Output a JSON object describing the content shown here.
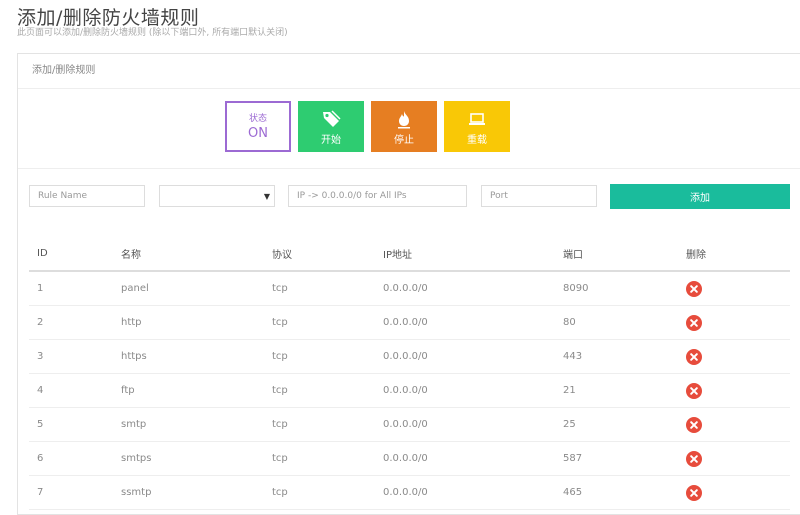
{
  "page": {
    "title": "添加/删除防火墙规则",
    "subtitle": "此页面可以添加/删除防火墙规则 (除以下端口外, 所有端口默认关闭)"
  },
  "panel": {
    "heading": "添加/删除规则"
  },
  "controls": {
    "status": {
      "label": "状态",
      "value": "ON"
    },
    "start": {
      "label": "开始",
      "icon": "tag-icon",
      "color": "#2ecc71"
    },
    "stop": {
      "label": "停止",
      "icon": "fire-icon",
      "color": "#e67e22"
    },
    "reload": {
      "label": "重载",
      "icon": "laptop-icon",
      "color": "#f9c806"
    }
  },
  "form": {
    "name_placeholder": "Rule Name",
    "protocol_selected": "",
    "ip_placeholder": "IP -> 0.0.0.0/0 for All IPs",
    "port_placeholder": "Port",
    "add_label": "添加",
    "add_color": "#1abc9c"
  },
  "table": {
    "headers": [
      "ID",
      "名称",
      "协议",
      "IP地址",
      "端口",
      "删除"
    ],
    "rows": [
      {
        "id": "1",
        "name": "panel",
        "protocol": "tcp",
        "ip": "0.0.0.0/0",
        "port": "8090"
      },
      {
        "id": "2",
        "name": "http",
        "protocol": "tcp",
        "ip": "0.0.0.0/0",
        "port": "80"
      },
      {
        "id": "3",
        "name": "https",
        "protocol": "tcp",
        "ip": "0.0.0.0/0",
        "port": "443"
      },
      {
        "id": "4",
        "name": "ftp",
        "protocol": "tcp",
        "ip": "0.0.0.0/0",
        "port": "21"
      },
      {
        "id": "5",
        "name": "smtp",
        "protocol": "tcp",
        "ip": "0.0.0.0/0",
        "port": "25"
      },
      {
        "id": "6",
        "name": "smtps",
        "protocol": "tcp",
        "ip": "0.0.0.0/0",
        "port": "587"
      },
      {
        "id": "7",
        "name": "ssmtp",
        "protocol": "tcp",
        "ip": "0.0.0.0/0",
        "port": "465"
      }
    ],
    "delete_icon": "delete-icon",
    "delete_color": "#e74c3c"
  }
}
